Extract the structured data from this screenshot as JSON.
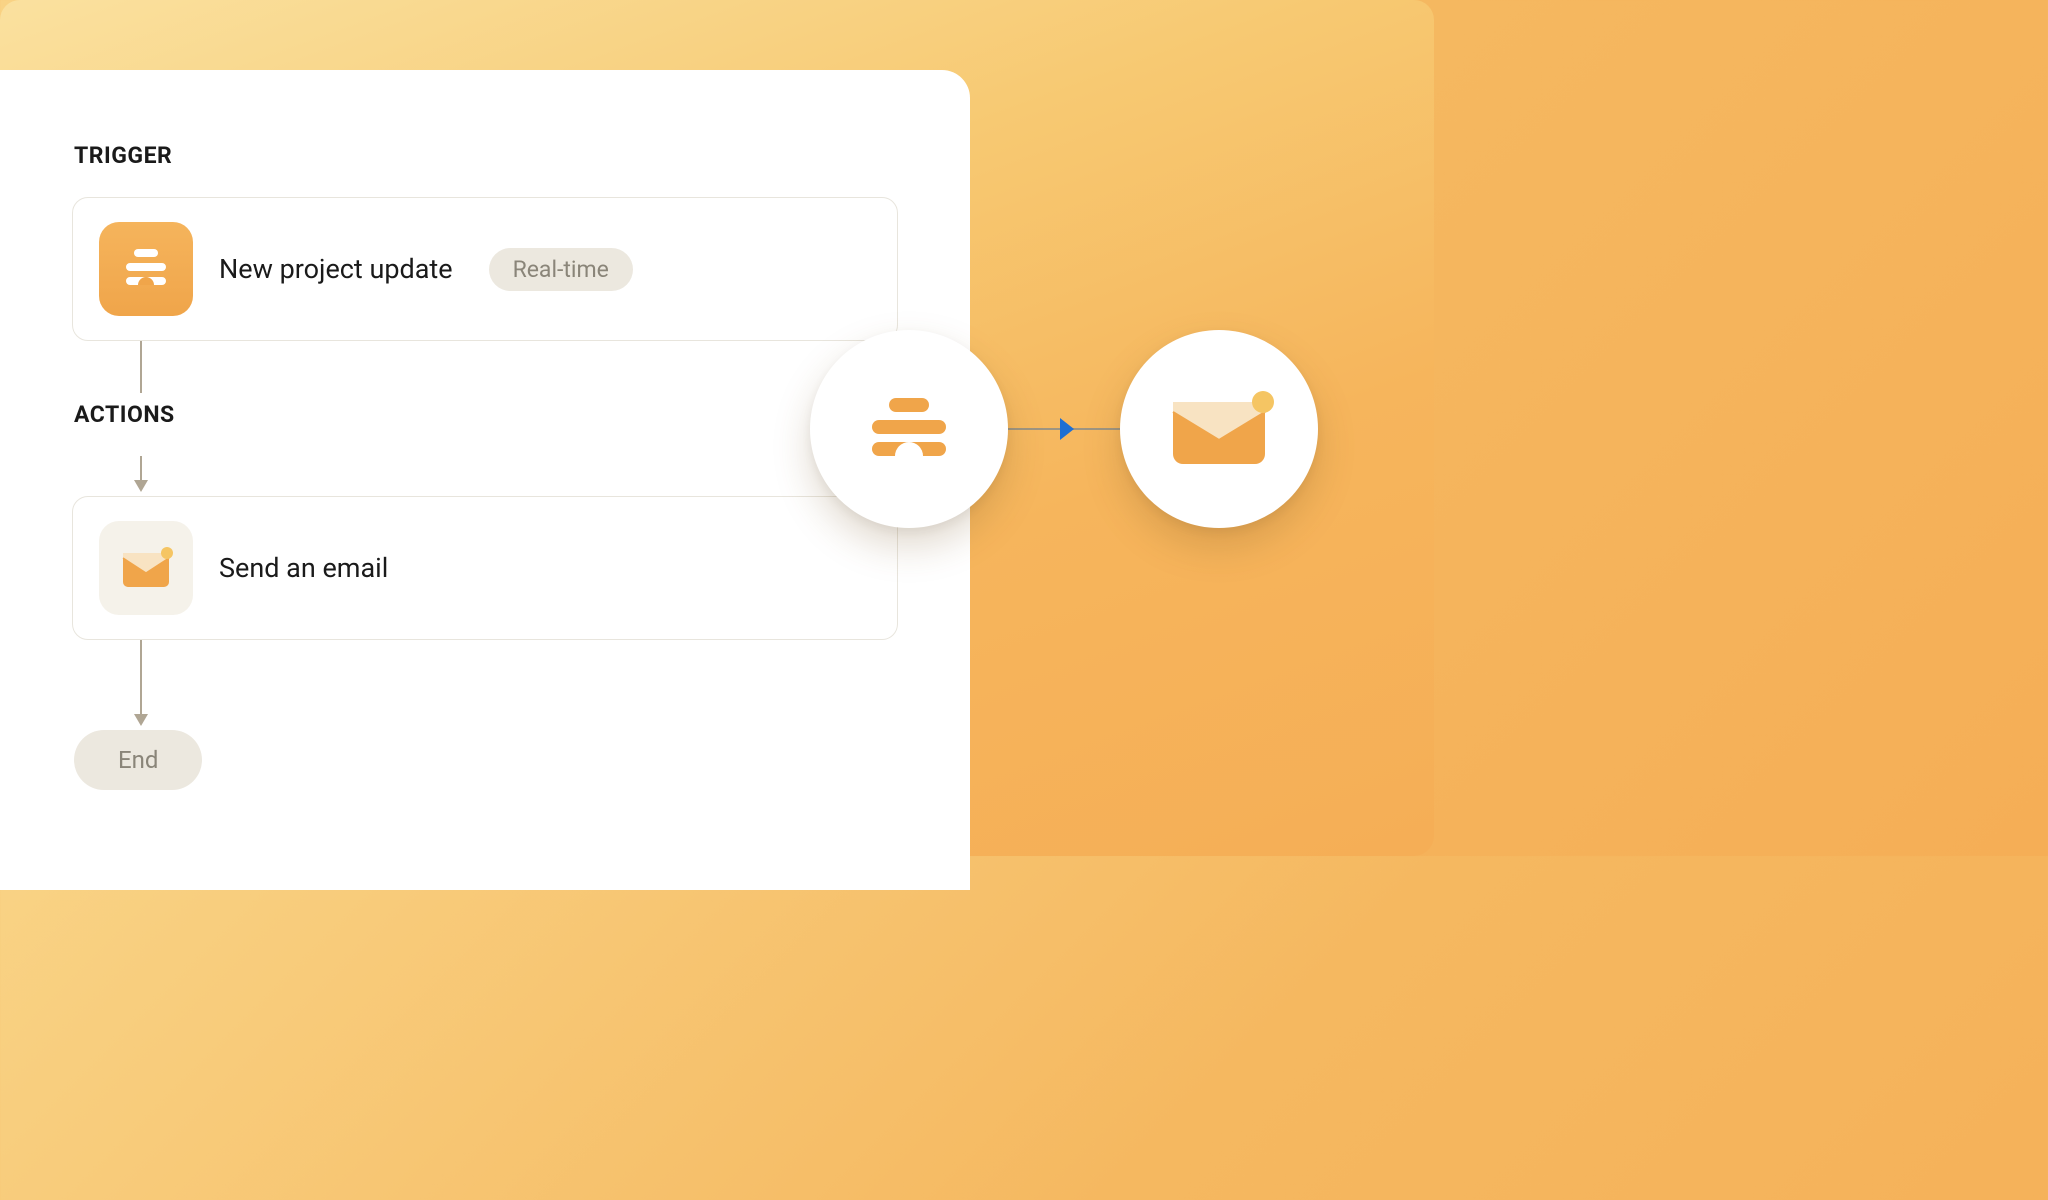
{
  "sections": {
    "trigger_label": "TRIGGER",
    "actions_label": "ACTIONS"
  },
  "trigger": {
    "title": "New project update",
    "badge": "Real-time",
    "icon": "stacked-lines-icon"
  },
  "action": {
    "title": "Send an email",
    "icon": "envelope-notification-icon"
  },
  "end": {
    "label": "End"
  },
  "flow": {
    "left_icon": "stacked-lines-icon",
    "right_icon": "envelope-notification-icon"
  },
  "colors": {
    "accent_orange": "#f0a54a",
    "badge_bg": "#ece8df",
    "badge_text": "#8a8579",
    "arrow_blue": "#1d6fd4"
  }
}
